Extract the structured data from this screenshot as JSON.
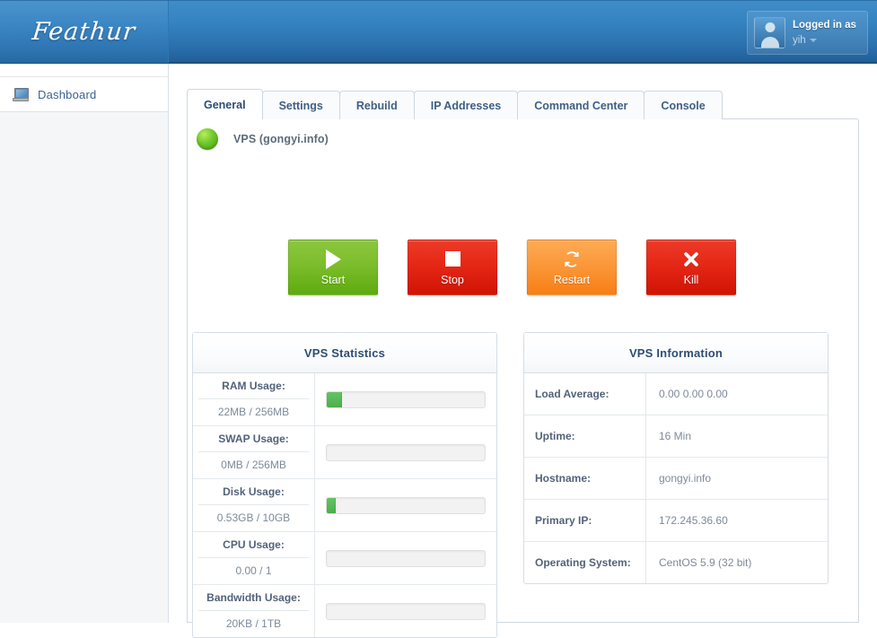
{
  "header": {
    "logo": "Feathur",
    "user": {
      "top_label": "Logged in as",
      "username": "yih",
      "avatar_icon": "user-avatar-icon",
      "caret_icon": "chevron-down-icon"
    }
  },
  "sidebar": {
    "items": [
      {
        "label": "Dashboard",
        "icon": "computer-monitor-icon"
      }
    ]
  },
  "tabs": [
    {
      "label": "General",
      "active": true
    },
    {
      "label": "Settings",
      "active": false
    },
    {
      "label": "Rebuild",
      "active": false
    },
    {
      "label": "IP Addresses",
      "active": false
    },
    {
      "label": "Command Center",
      "active": false
    },
    {
      "label": "Console",
      "active": false
    }
  ],
  "status": {
    "indicator_icon": "green-status-dot-icon",
    "indicator_color": "#6ec72a",
    "label": "VPS (gongyi.info)"
  },
  "actions": [
    {
      "label": "Start",
      "icon": "play-icon",
      "color": "#7cbd2c"
    },
    {
      "label": "Stop",
      "icon": "stop-square-icon",
      "color": "#e52716"
    },
    {
      "label": "Restart",
      "icon": "refresh-icon",
      "color": "#fb983a"
    },
    {
      "label": "Kill",
      "icon": "close-x-icon",
      "color": "#e52716"
    }
  ],
  "statistics": {
    "title": "VPS Statistics",
    "rows": [
      {
        "key": "RAM Usage:",
        "value": "22MB / 256MB",
        "percent": 9
      },
      {
        "key": "SWAP Usage:",
        "value": "0MB / 256MB",
        "percent": 0
      },
      {
        "key": "Disk Usage:",
        "value": "0.53GB / 10GB",
        "percent": 5
      },
      {
        "key": "CPU Usage:",
        "value": "0.00 / 1",
        "percent": 0
      },
      {
        "key": "Bandwidth Usage:",
        "value": "20KB / 1TB",
        "percent": 0
      }
    ]
  },
  "information": {
    "title": "VPS Information",
    "rows": [
      {
        "key": "Load Average:",
        "value": "0.00 0.00 0.00"
      },
      {
        "key": "Uptime:",
        "value": "16 Min"
      },
      {
        "key": "Hostname:",
        "value": "gongyi.info"
      },
      {
        "key": "Primary IP:",
        "value": "172.245.36.60"
      },
      {
        "key": "Operating System:",
        "value": "CentOS 5.9 (32 bit)"
      }
    ]
  }
}
